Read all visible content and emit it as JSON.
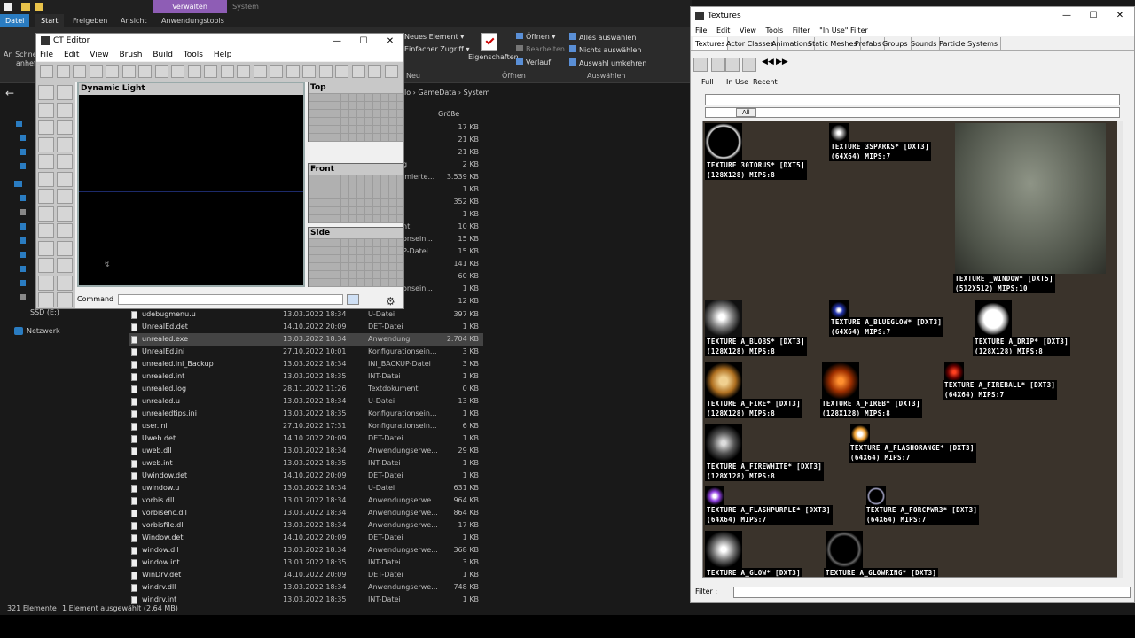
{
  "explorer": {
    "ribbon_tabs": [
      "Datei",
      "Start",
      "Freigeben",
      "Ansicht",
      "Anwendungstools"
    ],
    "context_tab": "Verwalten",
    "system_tab": "System",
    "ribbon": {
      "new_element": "Neues Element ▾",
      "easy_access": "Einfacher Zugriff ▾",
      "neu": "Neu",
      "properties": "Eigenschaften",
      "open": "Öffnen ▾",
      "edit": "Bearbeiten",
      "history": "Verlauf",
      "open_group": "Öffnen",
      "select_all": "Alles auswählen",
      "select_none": "Nichts auswählen",
      "invert": "Auswahl umkehren",
      "select_group": "Auswählen",
      "pin_left": "An Schnell",
      "pin_left2": "anhef"
    },
    "breadcrumb": [
      "lo",
      "GameData",
      "System"
    ],
    "col_size": "Größe",
    "nav": {
      "network": "Netzwerk",
      "ssd": "SSD (E:)"
    },
    "upper_sizes": [
      "17 KB",
      "21 KB",
      "21 KB",
      "2 KB",
      "3.539 KB",
      "1 KB",
      "352 KB",
      "1 KB",
      "10 KB",
      "15 KB",
      "15 KB",
      "141 KB",
      "60 KB",
      "1 KB",
      "12 KB"
    ],
    "upper_types": [
      "",
      "",
      "",
      "g",
      "imierte...",
      "",
      "",
      "",
      "nt",
      "onsein...",
      "P-Datei",
      "",
      "",
      "onsein...",
      ""
    ],
    "files": [
      {
        "n": "udebugmenu.u",
        "d": "13.03.2022 18:34",
        "t": "U-Datei",
        "s": "397 KB"
      },
      {
        "n": "UnrealEd.det",
        "d": "14.10.2022 20:09",
        "t": "DET-Datei",
        "s": "1 KB"
      },
      {
        "n": "unrealed.exe",
        "d": "13.03.2022 18:34",
        "t": "Anwendung",
        "s": "2.704 KB"
      },
      {
        "n": "UnrealEd.ini",
        "d": "27.10.2022 10:01",
        "t": "Konfigurationsein...",
        "s": "3 KB"
      },
      {
        "n": "unrealed.ini_Backup",
        "d": "13.03.2022 18:34",
        "t": "INI_BACKUP-Datei",
        "s": "3 KB"
      },
      {
        "n": "unrealed.int",
        "d": "13.03.2022 18:35",
        "t": "INT-Datei",
        "s": "1 KB"
      },
      {
        "n": "unrealed.log",
        "d": "28.11.2022 11:26",
        "t": "Textdokument",
        "s": "0 KB"
      },
      {
        "n": "unrealed.u",
        "d": "13.03.2022 18:34",
        "t": "U-Datei",
        "s": "13 KB"
      },
      {
        "n": "unrealedtips.ini",
        "d": "13.03.2022 18:35",
        "t": "Konfigurationsein...",
        "s": "1 KB"
      },
      {
        "n": "user.ini",
        "d": "27.10.2022 17:31",
        "t": "Konfigurationsein...",
        "s": "6 KB"
      },
      {
        "n": "Uweb.det",
        "d": "14.10.2022 20:09",
        "t": "DET-Datei",
        "s": "1 KB"
      },
      {
        "n": "uweb.dll",
        "d": "13.03.2022 18:34",
        "t": "Anwendungserwe...",
        "s": "29 KB"
      },
      {
        "n": "uweb.int",
        "d": "13.03.2022 18:35",
        "t": "INT-Datei",
        "s": "1 KB"
      },
      {
        "n": "Uwindow.det",
        "d": "14.10.2022 20:09",
        "t": "DET-Datei",
        "s": "1 KB"
      },
      {
        "n": "uwindow.u",
        "d": "13.03.2022 18:34",
        "t": "U-Datei",
        "s": "631 KB"
      },
      {
        "n": "vorbis.dll",
        "d": "13.03.2022 18:34",
        "t": "Anwendungserwe...",
        "s": "964 KB"
      },
      {
        "n": "vorbisenc.dll",
        "d": "13.03.2022 18:34",
        "t": "Anwendungserwe...",
        "s": "864 KB"
      },
      {
        "n": "vorbisfile.dll",
        "d": "13.03.2022 18:34",
        "t": "Anwendungserwe...",
        "s": "17 KB"
      },
      {
        "n": "Window.det",
        "d": "14.10.2022 20:09",
        "t": "DET-Datei",
        "s": "1 KB"
      },
      {
        "n": "window.dll",
        "d": "13.03.2022 18:34",
        "t": "Anwendungserwe...",
        "s": "368 KB"
      },
      {
        "n": "window.int",
        "d": "13.03.2022 18:35",
        "t": "INT-Datei",
        "s": "3 KB"
      },
      {
        "n": "WinDrv.det",
        "d": "14.10.2022 20:09",
        "t": "DET-Datei",
        "s": "1 KB"
      },
      {
        "n": "windrv.dll",
        "d": "13.03.2022 18:34",
        "t": "Anwendungserwe...",
        "s": "748 KB"
      },
      {
        "n": "windrv.int",
        "d": "13.03.2022 18:35",
        "t": "INT-Datei",
        "s": "1 KB"
      }
    ],
    "status": {
      "count": "321 Elemente",
      "selected": "1 Element ausgewählt (2,64 MB)"
    }
  },
  "ct": {
    "title": "CT Editor",
    "menu": [
      "File",
      "Edit",
      "View",
      "Brush",
      "Build",
      "Tools",
      "Help"
    ],
    "dyn_label": "Dynamic Light",
    "viewports": [
      "Top",
      "Front",
      "Side"
    ],
    "command_label": "Command"
  },
  "tex": {
    "title": "Textures",
    "menu": [
      "File",
      "Edit",
      "View",
      "Tools",
      "Filter",
      "\"In Use\" Filter"
    ],
    "tabs": [
      "Textures",
      "Actor Classes",
      "Animations",
      "Static Meshes",
      "Prefabs",
      "Groups",
      "Sounds",
      "Particle Systems"
    ],
    "subtabs": [
      "Full",
      "In Use",
      "Recent"
    ],
    "all_btn": "All",
    "filter_label": "Filter :",
    "items": [
      {
        "name": "Texture 30torus* [DXT5]",
        "info": "(128x128) Mips:8"
      },
      {
        "name": "Texture 3Sparks* [DXT3]",
        "info": "(64x64) Mips:7"
      },
      {
        "name": "Texture _window* [DXT5]",
        "info": "(512x512) Mips:10"
      },
      {
        "name": "Texture a_Blobs* [DXT3]",
        "info": "(128x128) Mips:8"
      },
      {
        "name": "Texture a_blueglow* [DXT3]",
        "info": "(64x64) Mips:7"
      },
      {
        "name": "Texture a_drip* [DXT3]",
        "info": "(128x128) Mips:8"
      },
      {
        "name": "Texture a_fire* [DXT3]",
        "info": "(128x128) Mips:8"
      },
      {
        "name": "Texture a_fireb* [DXT3]",
        "info": "(128x128) Mips:8"
      },
      {
        "name": "Texture a_fireball* [DXT3]",
        "info": "(64x64) Mips:7"
      },
      {
        "name": "Texture a_firewhite* [DXT3]",
        "info": "(128x128) Mips:8"
      },
      {
        "name": "Texture a_flashorange* [DXT3]",
        "info": "(64x64) Mips:7"
      },
      {
        "name": "Texture a_flashpurple* [DXT3]",
        "info": "(64x64) Mips:7"
      },
      {
        "name": "Texture a_forcpwr3* [DXT3]",
        "info": "(64x64) Mips:7"
      },
      {
        "name": "Texture a_glow* [DXT3]",
        "info": ""
      },
      {
        "name": "Texture a_glowring* [DXT3]",
        "info": ""
      }
    ]
  }
}
